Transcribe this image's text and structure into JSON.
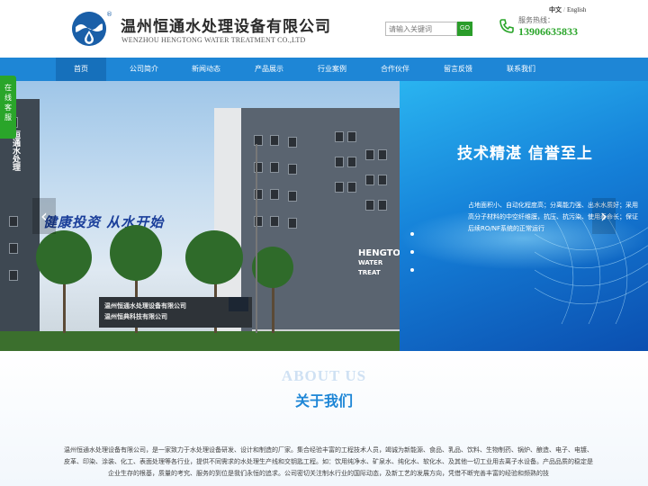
{
  "header": {
    "logo_icon": "water-drop-icon",
    "logo_reg": "®",
    "company_cn": "温州恒通水处理设备有限公司",
    "company_en": "WENZHOU HENGTONG WATER TREATMENT CO.,LTD",
    "search_placeholder": "请输入关键词",
    "search_button": "GO",
    "lang_cn": "中文",
    "lang_sep": "/",
    "lang_en": "English",
    "hotline_icon": "phone-icon",
    "hotline_label": "服务热线：",
    "hotline_number": "13906635833"
  },
  "nav": {
    "items": [
      {
        "label": "首页",
        "active": true
      },
      {
        "label": "公司简介"
      },
      {
        "label": "新闻动态"
      },
      {
        "label": "产品展示"
      },
      {
        "label": "行业案例"
      },
      {
        "label": "合作伙伴"
      },
      {
        "label": "留言反馈"
      },
      {
        "label": "联系我们"
      }
    ]
  },
  "side_service": {
    "label": "在线客服"
  },
  "banner": {
    "slogan": "健康投资 从水开始",
    "left_sign": "恒通水处理",
    "company_sign_line1": "温州恒通水处理设备有限公司",
    "company_sign_line2": "温州恒典科技有限公司",
    "building_sign_line1": "HENGTO",
    "building_sign_line2": "WATER TREAT",
    "panel_title": "技术精湛  信誉至上",
    "panel_text": "占地面积小、自动化程度高；分离能力强、出水水质好；采用高分子材料的中空纤维膜，抗压、抗污染、使用寿命长；保证后续RO/NF系统的正常运行",
    "arrow_left": "‹",
    "arrow_right": "›"
  },
  "about": {
    "title_en": "ABOUT US",
    "title_cn": "关于我们",
    "text": "温州恒通水处理设备有限公司，是一家致力于水处理设备研发、设计和制造的厂家。集合经验丰富的工程技术人员，竭诚为新能源、食品、乳品、饮料、生物制药、锅炉、酿造、电子、电镀、皮革、印染、涂装、化工、表面处理等各行业，提供不同需求的水处理生产线和交钥匙工程。如：饮用纯净水、矿泉水、纯化水、软化水、及其他一切工业用去离子水设备。产品品质的稳定是企业生存的根基，质量的考究、服务的到位是我们永恒的追求。公司密切关注制水行业的国际动态，及新工艺的发展方向，凭借不断完善丰富的经验和频熟的技"
  }
}
